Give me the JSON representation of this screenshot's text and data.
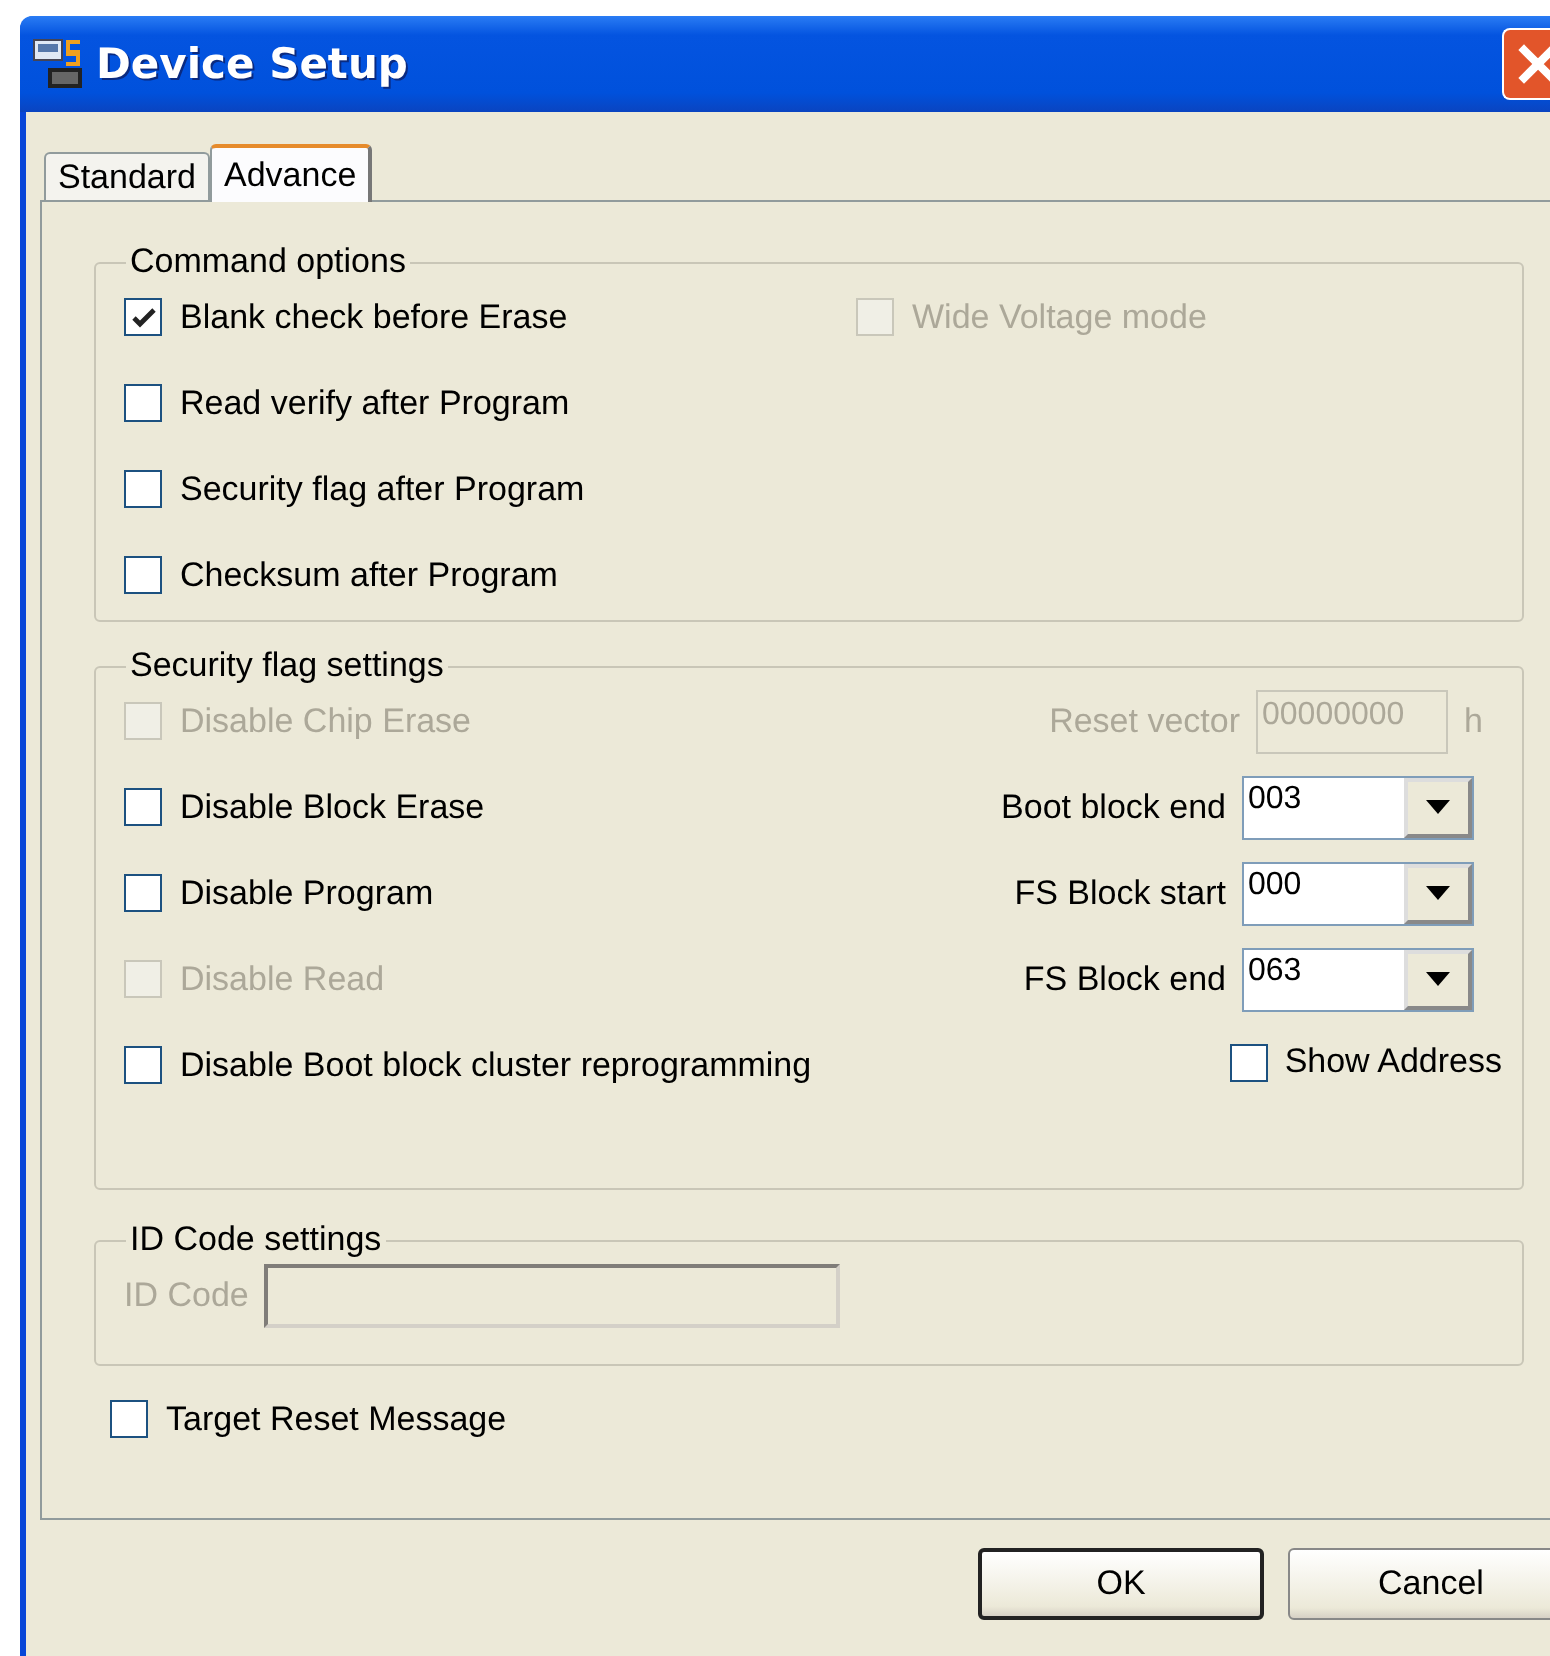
{
  "window": {
    "title": "Device Setup"
  },
  "tabs": [
    {
      "label": "Standard",
      "selected": false
    },
    {
      "label": "Advance",
      "selected": true
    }
  ],
  "command_options": {
    "title": "Command options",
    "checkboxes": [
      {
        "label": "Blank check before Erase",
        "checked": true,
        "disabled": false
      },
      {
        "label": "Read verify after Program",
        "checked": false,
        "disabled": false
      },
      {
        "label": "Security flag after Program",
        "checked": false,
        "disabled": false
      },
      {
        "label": "Checksum after Program",
        "checked": false,
        "disabled": false
      }
    ],
    "wide_voltage": {
      "label": "Wide Voltage mode",
      "checked": false,
      "disabled": true
    }
  },
  "security_flag_settings": {
    "title": "Security flag settings",
    "checkboxes": [
      {
        "label": "Disable Chip Erase",
        "checked": false,
        "disabled": true
      },
      {
        "label": "Disable Block Erase",
        "checked": false,
        "disabled": false
      },
      {
        "label": "Disable Program",
        "checked": false,
        "disabled": false
      },
      {
        "label": "Disable Read",
        "checked": false,
        "disabled": true
      },
      {
        "label": "Disable Boot block cluster reprogramming",
        "checked": false,
        "disabled": false
      }
    ],
    "fields": [
      {
        "kind": "text",
        "label": "Reset vector",
        "value": "00000000",
        "suffix": "h",
        "disabled": true
      },
      {
        "kind": "dropdown",
        "label": "Boot block end",
        "value": "003",
        "disabled": false
      },
      {
        "kind": "dropdown",
        "label": "FS Block start",
        "value": "000",
        "disabled": false
      },
      {
        "kind": "dropdown",
        "label": "FS Block end",
        "value": "063",
        "disabled": false
      }
    ],
    "show_address": {
      "label": "Show Address",
      "checked": false,
      "disabled": false
    }
  },
  "id_code_settings": {
    "title": "ID Code settings",
    "label": "ID Code",
    "disabled": true
  },
  "target_reset_message": {
    "label": "Target Reset Message",
    "checked": false,
    "disabled": false
  },
  "buttons": [
    {
      "label": "OK",
      "default": true
    },
    {
      "label": "Cancel",
      "default": false
    }
  ]
}
